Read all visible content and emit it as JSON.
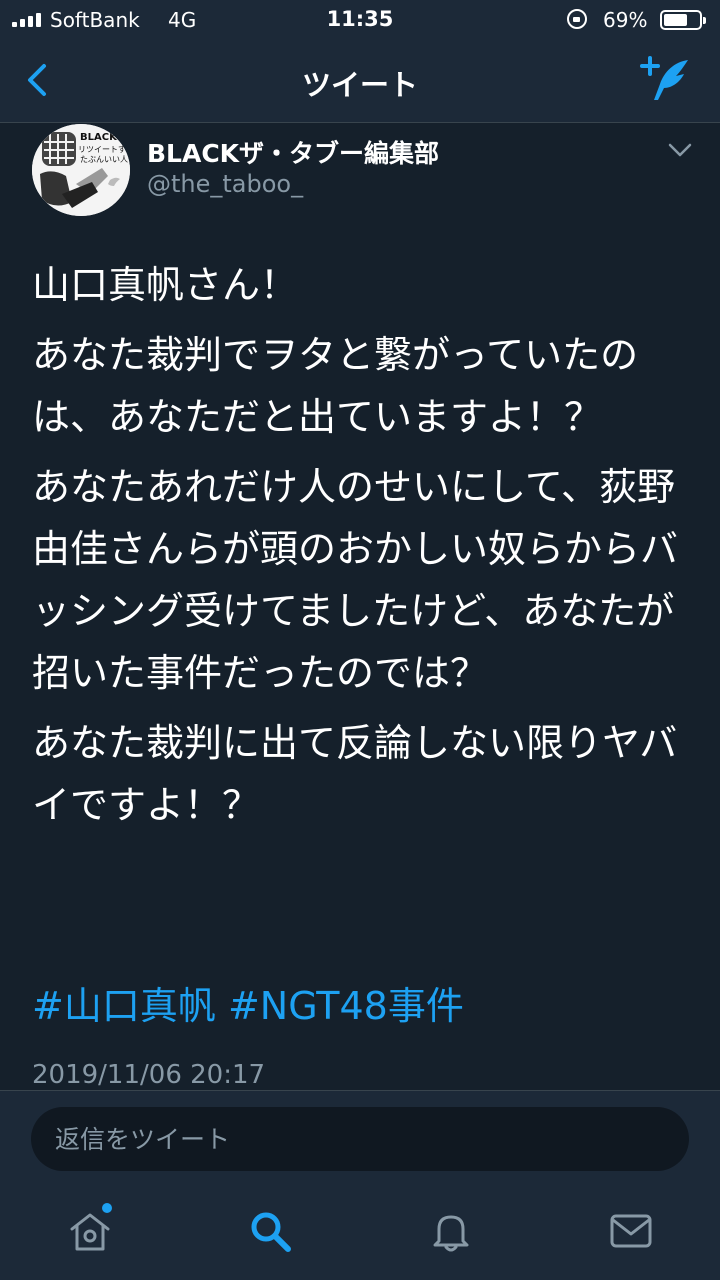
{
  "status_bar": {
    "carrier": "SoftBank",
    "network": "4G",
    "time": "11:35",
    "battery_percent": "69%",
    "battery_level": 0.69
  },
  "header": {
    "title": "ツイート",
    "back_icon": "chevron-left-icon",
    "compose_icon": "compose-tweet-icon"
  },
  "tweet": {
    "author_name": "BLACKザ・タブー編集部",
    "author_handle": "@the_taboo_",
    "avatar_text_1": "BLACK",
    "avatar_text_2": "リツイートする人",
    "avatar_text_3": "たぶんいい人",
    "paragraphs": [
      "山口真帆さん！",
      "あなた裁判でヲタと繋がっていたのは、あなただと出ていますよ！？",
      "あなたあれだけ人のせいにして、荻野由佳さんらが頭のおかしい奴らからバッシング受けてましたけど、あなたが招いた事件だったのでは？",
      "あなた裁判に出て反論しない限りヤバイですよ！？"
    ],
    "hashtags": [
      "#山口真帆",
      "#NGT48事件"
    ],
    "timestamp": "2019/11/06 20:17"
  },
  "reply": {
    "placeholder": "返信をツイート"
  },
  "tabbar": {
    "items": [
      {
        "name": "home",
        "icon": "home-icon",
        "has_notification_dot": true
      },
      {
        "name": "search",
        "icon": "search-icon",
        "active": true
      },
      {
        "name": "notifications",
        "icon": "bell-icon"
      },
      {
        "name": "messages",
        "icon": "envelope-icon"
      }
    ]
  },
  "colors": {
    "background": "#15202b",
    "bar_background": "#1c2938",
    "accent": "#1da1f2",
    "secondary_text": "#8899a6"
  }
}
